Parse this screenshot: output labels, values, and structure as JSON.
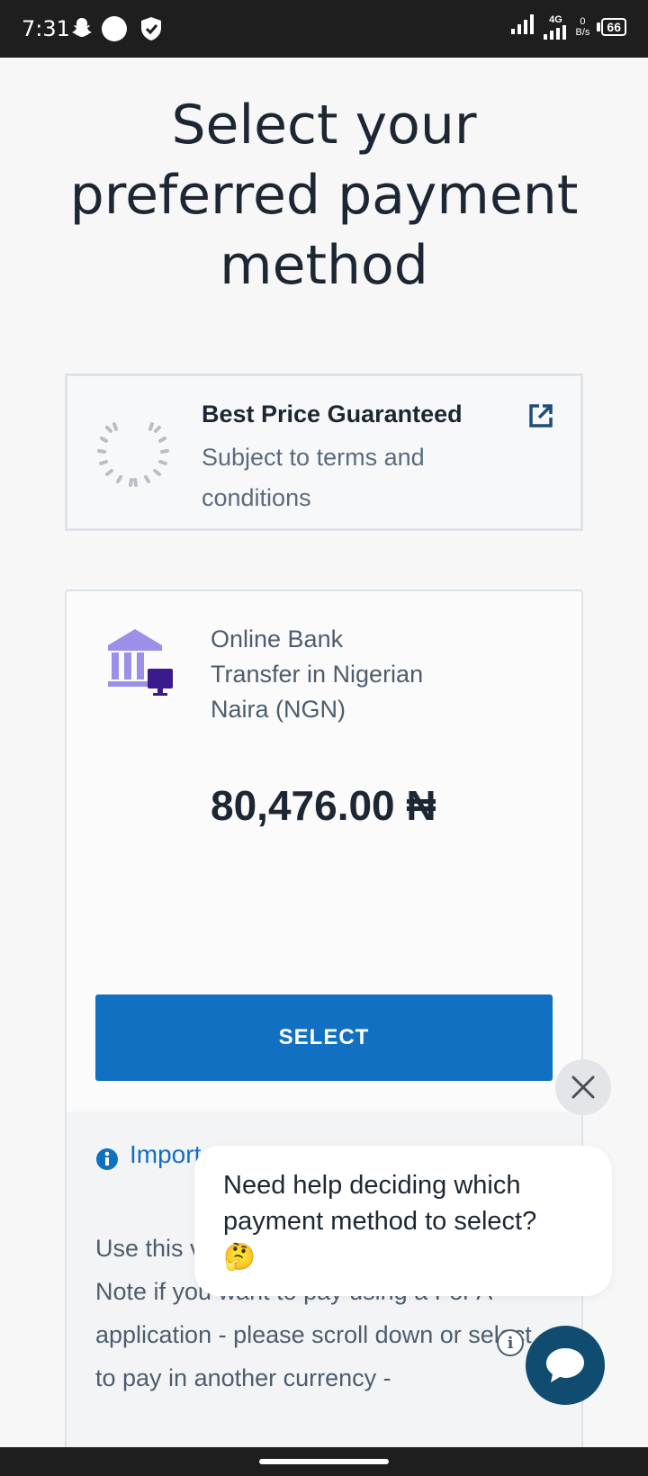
{
  "status_bar": {
    "time": "7:31",
    "network": "4G",
    "data_rate_value": "0",
    "data_rate_unit": "B/s",
    "battery": "66"
  },
  "page": {
    "title": "Select your preferred payment method"
  },
  "guarantee": {
    "title": "Best Price Guaranteed",
    "subtitle": "Subject to terms and conditions"
  },
  "payment_method": {
    "name": "Online Bank Transfer in Nigerian Naira (NGN)",
    "amount": "80,476.00 ₦",
    "select_label": "SELECT",
    "important_label": "Import",
    "info_text": "Use this via Bank Transfer.\nNote if you want to pay using a For A application - please scroll down or select to pay in another currency -"
  },
  "help_chat": {
    "message": "Need help deciding which payment method to select?",
    "emoji": "🤔"
  },
  "colors": {
    "accent": "#1270c2",
    "chat_button": "#0f4c6f",
    "bank_icon": "#9b8fe8",
    "bank_icon_screen": "#3a1a8c"
  },
  "icons": [
    "snapchat-icon",
    "circle-notification-icon",
    "shield-icon",
    "signal-icon",
    "battery-icon",
    "laurel-icon",
    "external-link-icon",
    "bank-icon",
    "info-icon",
    "close-icon",
    "chat-icon"
  ]
}
